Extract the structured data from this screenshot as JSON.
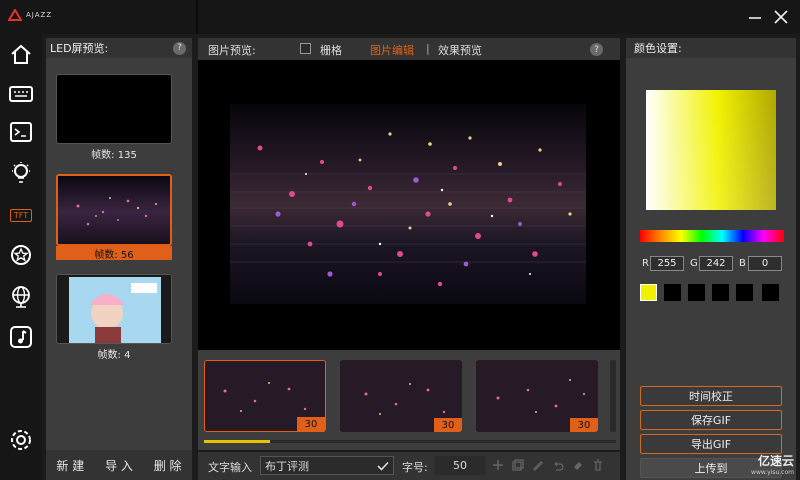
{
  "app": {
    "brand": "AJAZZ",
    "brand_color": "#e8302a"
  },
  "window": {
    "minimize_icon": "minimize-icon",
    "close_icon": "close-icon"
  },
  "sidebar": {
    "items": [
      "home-icon",
      "keyboard-icon",
      "terminal-icon",
      "lightbulb-icon",
      "tft-icon",
      "star-icon",
      "globe-icon",
      "music-note-icon"
    ],
    "tft_label": "TFT",
    "settings_icon": "gear-icon"
  },
  "led_panel": {
    "title": "LED屏预览:",
    "help": "?",
    "items": [
      {
        "caption": "帧数: 135"
      },
      {
        "caption": "帧数: 56"
      },
      {
        "caption": "帧数: 4"
      }
    ],
    "buttons": {
      "new": "新 建",
      "import": "导 入",
      "delete": "删 除"
    }
  },
  "preview": {
    "title": "图片预览:",
    "grid_label": "栅格",
    "tab_edit": "图片编辑",
    "separator": "|",
    "tab_effect": "效果预览",
    "help": "?"
  },
  "frames": {
    "items": [
      {
        "count": "30"
      },
      {
        "count": "30"
      },
      {
        "count": "30"
      }
    ],
    "progress": 0.16
  },
  "text_bar": {
    "label": "文字输入",
    "value": "布丁评测",
    "size_label": "字号:",
    "size_value": "50"
  },
  "color_panel": {
    "title": "颜色设置:",
    "r_label": "R",
    "r": "255",
    "g_label": "G",
    "g": "242",
    "b_label": "B",
    "b": "0",
    "selected_color": "#f2f200",
    "buttons": {
      "time": "时间校正",
      "save": "保存GIF",
      "export": "导出GIF",
      "upload": "上传到"
    }
  },
  "watermark": {
    "text": "亿速云",
    "sub": "www.yisu.com"
  },
  "colors": {
    "accent": "#e0601a",
    "progress": "#e6c200"
  }
}
